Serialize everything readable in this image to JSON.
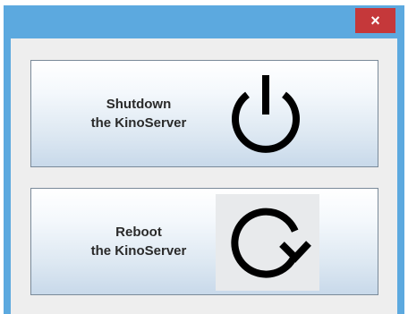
{
  "window": {
    "close_glyph": "×"
  },
  "buttons": {
    "shutdown": {
      "line1": "Shutdown",
      "line2": "the KinoServer",
      "icon": "power-icon"
    },
    "reboot": {
      "line1": "Reboot",
      "line2": "the KinoServer",
      "icon": "reboot-icon"
    }
  },
  "colors": {
    "titlebar": "#5ca9df",
    "close_button": "#c5383a",
    "client_background": "#eeeeee",
    "button_text": "#2a2a2a"
  }
}
